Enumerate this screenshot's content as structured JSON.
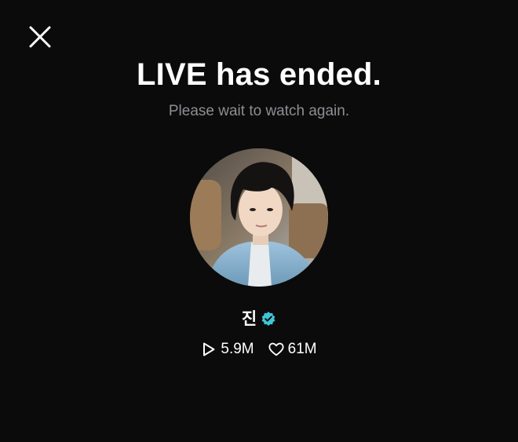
{
  "header": {
    "close_icon": "close-icon"
  },
  "message": {
    "title": "LIVE has ended.",
    "subtitle": "Please wait to watch again."
  },
  "channel": {
    "name": "진",
    "verified_icon": "verified-badge-icon",
    "verified_color": "#3fc6d6",
    "plays_icon": "play-icon",
    "plays": "5.9M",
    "likes_icon": "heart-icon",
    "likes": "61M"
  },
  "colors": {
    "background": "#0b0b0c",
    "title": "#ffffff",
    "subtitle": "#8e8e93"
  }
}
